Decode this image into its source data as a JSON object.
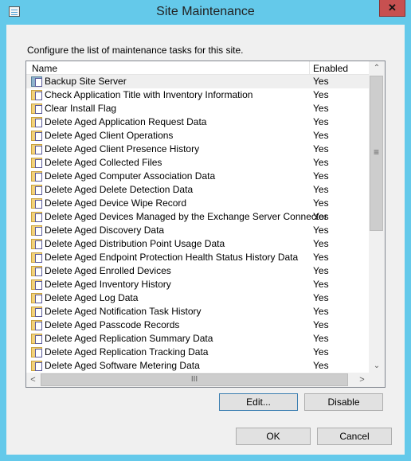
{
  "window": {
    "title": "Site Maintenance",
    "close_label": "✕"
  },
  "instruction": "Configure the list of maintenance tasks for this site.",
  "columns": {
    "name": "Name",
    "enabled": "Enabled"
  },
  "tasks": [
    {
      "name": "Backup Site Server",
      "enabled": "Yes",
      "icon": "server-icon"
    },
    {
      "name": "Check Application Title with Inventory Information",
      "enabled": "Yes",
      "icon": "folder-icon"
    },
    {
      "name": "Clear Install Flag",
      "enabled": "Yes",
      "icon": "folder-icon"
    },
    {
      "name": "Delete Aged Application Request Data",
      "enabled": "Yes",
      "icon": "folder-icon"
    },
    {
      "name": "Delete Aged Client Operations",
      "enabled": "Yes",
      "icon": "folder-icon"
    },
    {
      "name": "Delete Aged Client Presence History",
      "enabled": "Yes",
      "icon": "folder-icon"
    },
    {
      "name": "Delete Aged Collected Files",
      "enabled": "Yes",
      "icon": "folder-icon"
    },
    {
      "name": "Delete Aged Computer Association Data",
      "enabled": "Yes",
      "icon": "folder-icon"
    },
    {
      "name": "Delete Aged Delete Detection Data",
      "enabled": "Yes",
      "icon": "folder-icon"
    },
    {
      "name": "Delete Aged Device Wipe Record",
      "enabled": "Yes",
      "icon": "folder-icon"
    },
    {
      "name": "Delete Aged Devices Managed by the Exchange Server Connector",
      "enabled": "Yes",
      "icon": "folder-icon"
    },
    {
      "name": "Delete Aged Discovery Data",
      "enabled": "Yes",
      "icon": "folder-icon"
    },
    {
      "name": "Delete Aged Distribution Point Usage Data",
      "enabled": "Yes",
      "icon": "folder-icon"
    },
    {
      "name": "Delete Aged Endpoint Protection Health Status History Data",
      "enabled": "Yes",
      "icon": "folder-icon"
    },
    {
      "name": "Delete Aged Enrolled Devices",
      "enabled": "Yes",
      "icon": "folder-icon"
    },
    {
      "name": "Delete Aged Inventory History",
      "enabled": "Yes",
      "icon": "folder-icon"
    },
    {
      "name": "Delete Aged Log Data",
      "enabled": "Yes",
      "icon": "folder-icon"
    },
    {
      "name": "Delete Aged Notification Task History",
      "enabled": "Yes",
      "icon": "folder-icon"
    },
    {
      "name": "Delete Aged Passcode Records",
      "enabled": "Yes",
      "icon": "folder-icon"
    },
    {
      "name": "Delete Aged Replication Summary Data",
      "enabled": "Yes",
      "icon": "folder-icon"
    },
    {
      "name": "Delete Aged Replication Tracking Data",
      "enabled": "Yes",
      "icon": "folder-icon"
    },
    {
      "name": "Delete Aged Software Metering Data",
      "enabled": "Yes",
      "icon": "folder-icon"
    }
  ],
  "buttons": {
    "edit": "Edit...",
    "disable": "Disable",
    "ok": "OK",
    "cancel": "Cancel"
  },
  "colors": {
    "frame": "#64c9ea",
    "close": "#c75050"
  }
}
